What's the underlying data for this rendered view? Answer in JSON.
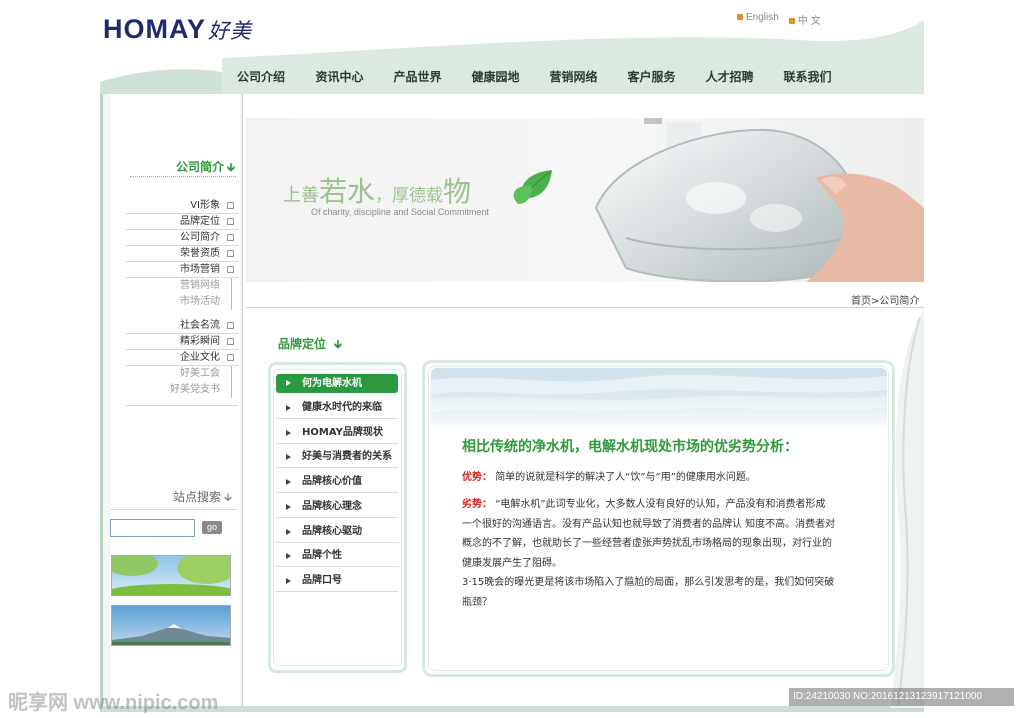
{
  "header": {
    "logo_text": "HOMAY",
    "logo_cn": "好美",
    "lang_en": "English",
    "lang_cn": "中 文"
  },
  "nav": {
    "items": [
      "公司介绍",
      "资讯中心",
      "产品世界",
      "健康园地",
      "营销网络",
      "客户服务",
      "人才招聘",
      "联系我们"
    ]
  },
  "sidebar": {
    "section_title": "公司简介",
    "items": [
      {
        "label": "VI形象",
        "sub": false
      },
      {
        "label": "品牌定位",
        "sub": false
      },
      {
        "label": "公司简介",
        "sub": false
      },
      {
        "label": "荣誉资质",
        "sub": false
      },
      {
        "label": "市场营销",
        "sub": false
      },
      {
        "label": "营销网络",
        "sub": true
      },
      {
        "label": "市场活动",
        "sub": true
      },
      {
        "label": "社会名流",
        "sub": false
      },
      {
        "label": "精彩瞬间",
        "sub": false
      },
      {
        "label": "企业文化",
        "sub": false
      },
      {
        "label": "好美工会",
        "sub": true
      },
      {
        "label": "好美党支书",
        "sub": true
      }
    ],
    "search_title": "站点搜索",
    "go_label": "go"
  },
  "banner": {
    "slogan_1": "上善",
    "slogan_2": "若水",
    "slogan_3": "，厚德载",
    "slogan_4": "物",
    "slogan_en": "Of charity, discipline and Social Commitment"
  },
  "breadcrumb": "首页>公司简介",
  "content": {
    "section_title": "品牌定位",
    "tabs": [
      "何为电解水机",
      "健康水时代的来临",
      "HOMAY品牌现状",
      "好美与消费者的关系",
      "品牌核心价值",
      "品牌核心理念",
      "品牌核心驱动",
      "品牌个性",
      "品牌口号"
    ],
    "active_tab": 0,
    "headline": "相比传统的净水机，电解水机现处市场的优劣势分析：",
    "adv_label": "优势：",
    "adv_text": "简单的说就是科学的解决了人“饮”与“用”的健康用水问题。",
    "disadv_label": "劣势：",
    "disadv_line1": "“电解水机”此词专业化，大多数人没有良好的认知，产品没有和消费者形成",
    "disadv_line2": "一个很好的沟通语言。没有产品认知也就导致了消费者的品牌认 知度不高。消费者对",
    "disadv_line3": "概念的不了解，也就助长了一些经营者虚张声势扰乱市场格局的现象出现，对行业的",
    "disadv_line4": "健康发展产生了阻碍。",
    "extra_line1": "3·15晚会的曝光更是将该市场陷入了尴尬的局面，那么引发思考的是，我们如何突破",
    "extra_line2": "瓶颈？"
  },
  "watermark": {
    "left": "昵享网 www.nipic.com",
    "right": "ID:24210030 NO:20161213123917121000"
  },
  "colors": {
    "brand_green": "#2b9a3e",
    "logo_navy": "#1f2a6e",
    "frame_mint": "#d9e8df",
    "alert_red": "#d8231f"
  }
}
